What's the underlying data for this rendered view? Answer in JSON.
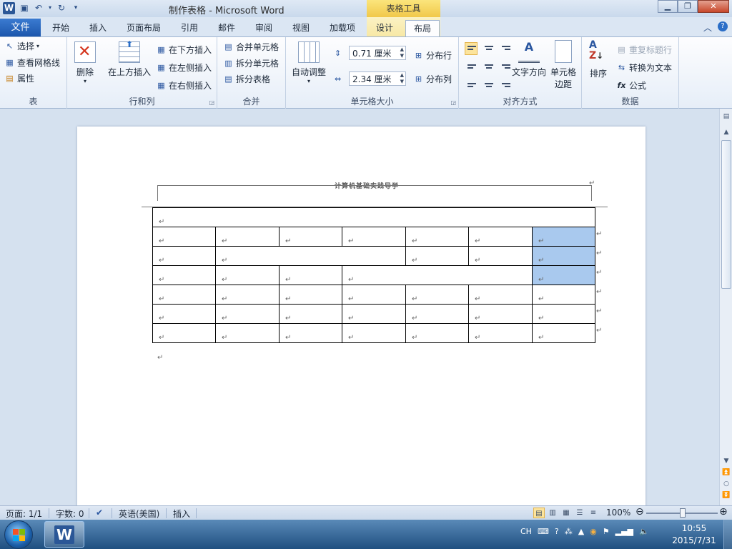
{
  "title_bar": {
    "window_title": "制作表格 - Microsoft Word",
    "context_header": "表格工具",
    "qat": [
      "save-icon",
      "undo-icon",
      "redo-icon",
      "customize-icon"
    ]
  },
  "tabs": {
    "file": "文件",
    "items": [
      "开始",
      "插入",
      "页面布局",
      "引用",
      "邮件",
      "审阅",
      "视图",
      "加载项",
      "设计",
      "布局"
    ],
    "active": "布局"
  },
  "ribbon": {
    "group_table": {
      "title": "表",
      "select": "选择",
      "gridlines": "查看网格线",
      "properties": "属性"
    },
    "group_rowscols": {
      "title": "行和列",
      "delete": "删除",
      "insert_above": "在上方插入",
      "insert_below": "在下方插入",
      "insert_left": "在左侧插入",
      "insert_right": "在右侧插入"
    },
    "group_merge": {
      "title": "合并",
      "merge_cells": "合并单元格",
      "split_cells": "拆分单元格",
      "split_table": "拆分表格"
    },
    "group_cellsize": {
      "title": "单元格大小",
      "autofit": "自动调整",
      "height": "0.71 厘米",
      "width": "2.34 厘米",
      "distribute_rows": "分布行",
      "distribute_cols": "分布列"
    },
    "group_align": {
      "title": "对齐方式",
      "text_direction": "文字方向",
      "cell_margins_line1": "单元格",
      "cell_margins_line2": "边距"
    },
    "group_data": {
      "title": "数据",
      "sort": "排序",
      "repeat_header": "重复标题行",
      "convert_text": "转换为文本",
      "formula": "公式"
    }
  },
  "document": {
    "header_text": "计算机基础实践导学",
    "paragraph_mark": "↵",
    "selected_column": 6
  },
  "status_bar": {
    "page": "页面: 1/1",
    "words": "字数: 0",
    "language": "英语(美国)",
    "mode": "插入",
    "zoom": "100%"
  },
  "taskbar": {
    "lang": "CH",
    "time": "10:55",
    "date": "2015/7/31"
  }
}
